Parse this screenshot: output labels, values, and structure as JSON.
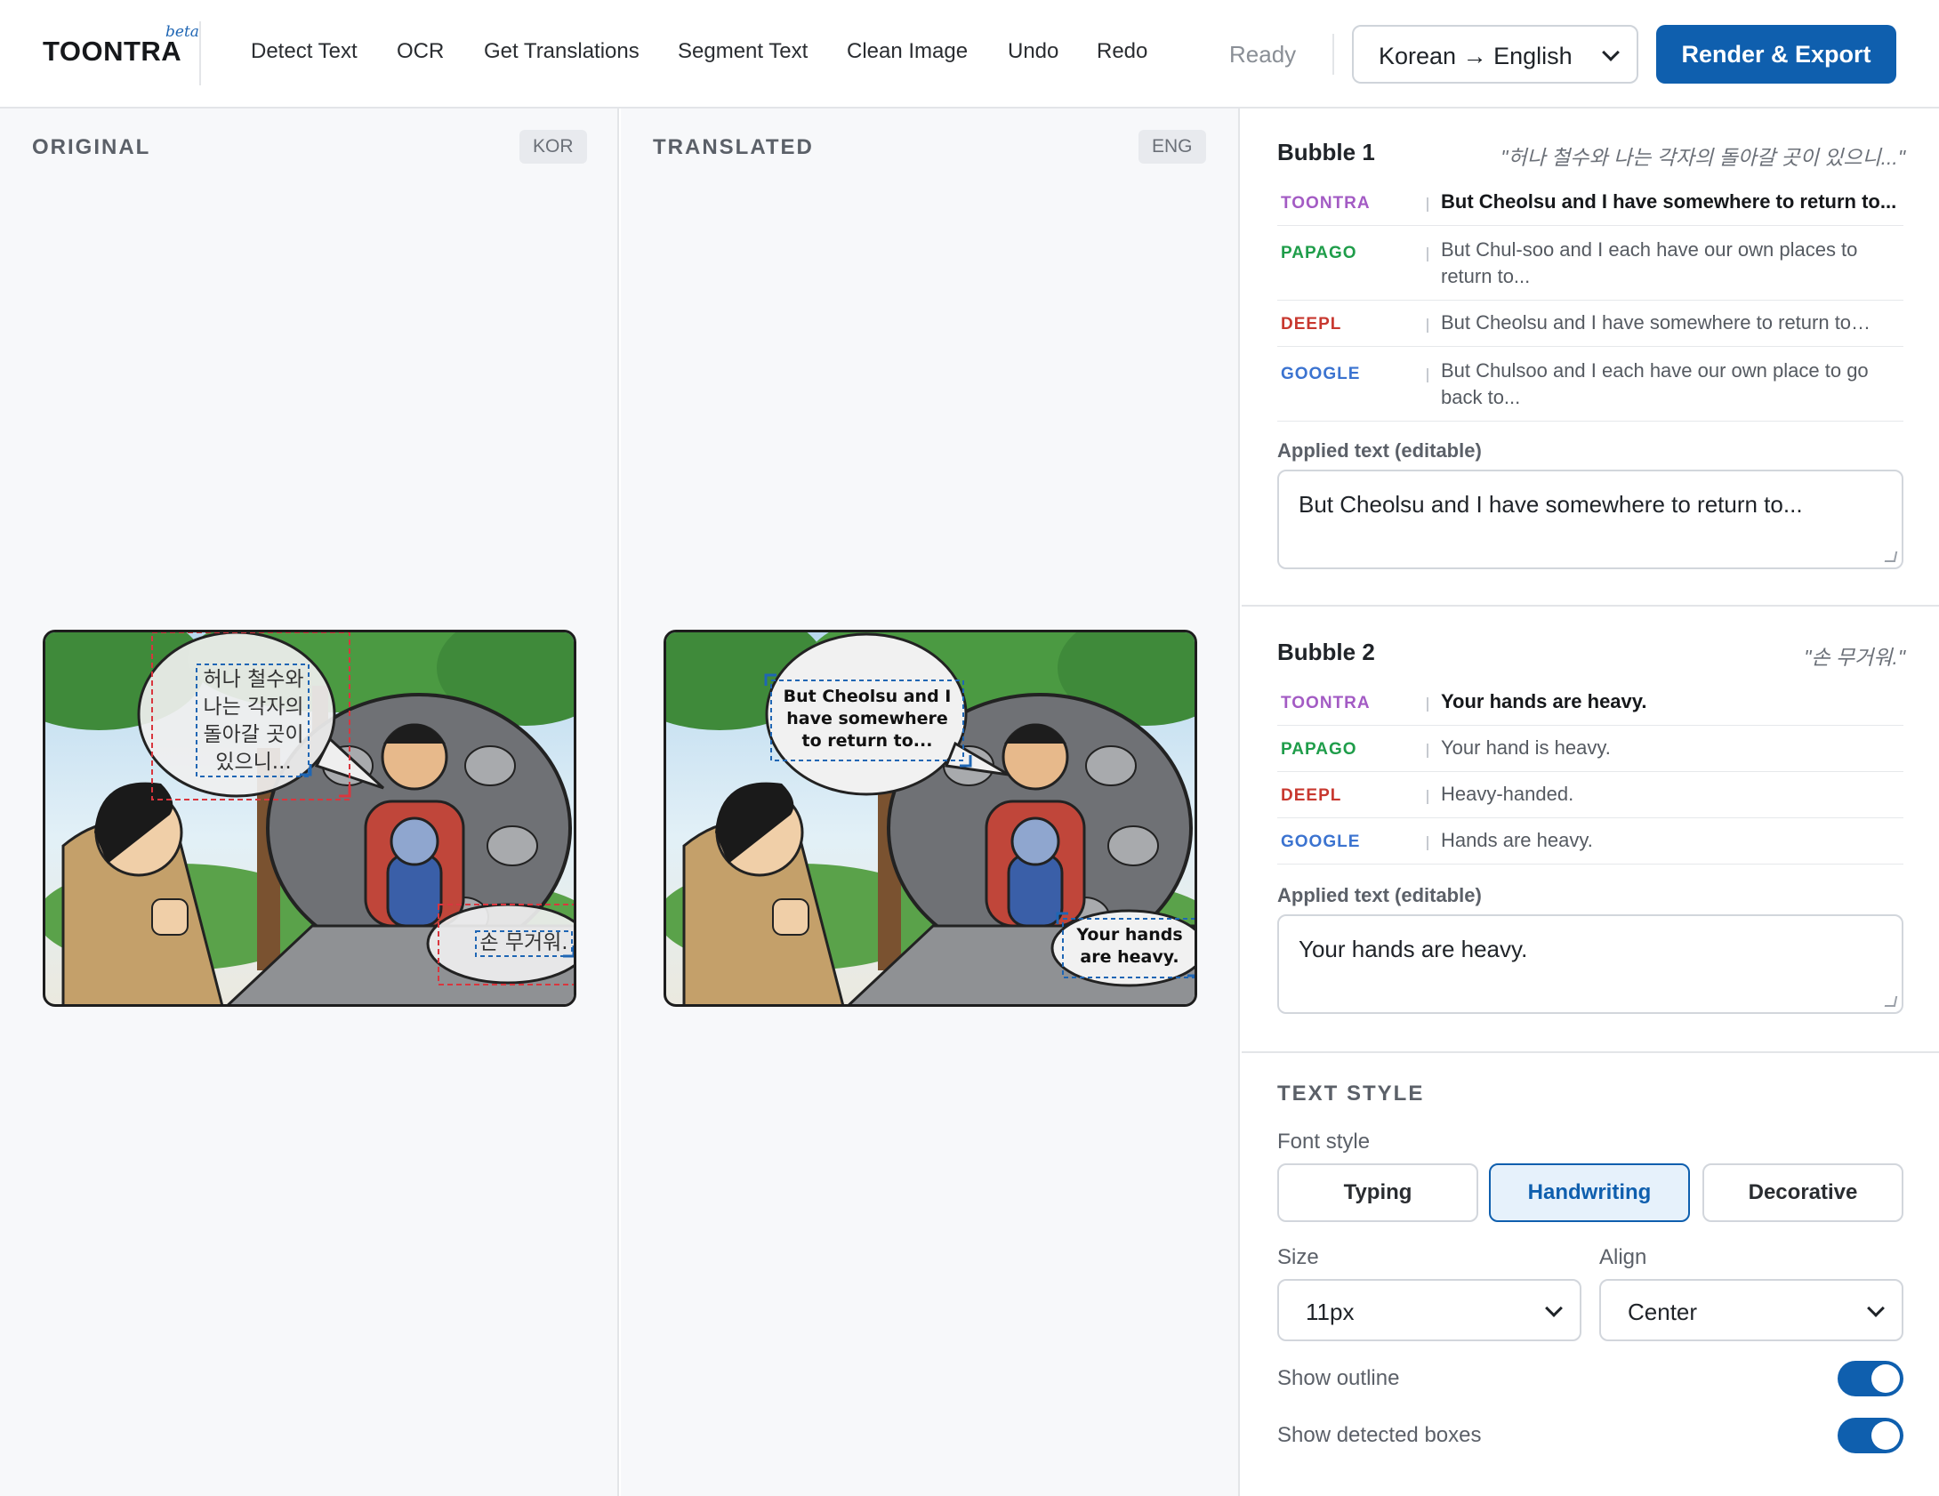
{
  "app": {
    "logo": "TOONTRA",
    "beta": "beta"
  },
  "toolbar": {
    "items": [
      "Detect Text",
      "OCR",
      "Get Translations",
      "Segment Text",
      "Clean Image",
      "Undo",
      "Redo"
    ],
    "status": "Ready",
    "language": "Korean → English",
    "export_label": "Render & Export"
  },
  "panes": {
    "original": {
      "title": "ORIGINAL",
      "badge": "KOR"
    },
    "translated": {
      "title": "TRANSLATED",
      "badge": "ENG"
    }
  },
  "comic": {
    "original": {
      "bubble1": [
        "허나 철수와",
        "나는 각자의",
        "돌아갈 곳이",
        "있으니..."
      ],
      "bubble2": "손 무거워."
    },
    "translated": {
      "bubble1": [
        "But Cheolsu and I",
        "have somewhere",
        "to return to..."
      ],
      "bubble2": [
        "Your hands",
        "are heavy."
      ]
    }
  },
  "bubbles": [
    {
      "title": "Bubble 1",
      "source": "\"허나 철수와 나는 각자의 돌아갈 곳이 있으니...\"",
      "engines": [
        {
          "name": "TOONTRA",
          "color": "#a35bc4",
          "text": "But Cheolsu and I have somewhere to return to..."
        },
        {
          "name": "PAPAGO",
          "color": "#1f9d4a",
          "text": "But Chul-soo and I each have our own places to return to..."
        },
        {
          "name": "DEEPL",
          "color": "#c8382f",
          "text": "But Cheolsu and I have somewhere to return to…"
        },
        {
          "name": "GOOGLE",
          "color": "#3b73d0",
          "text": "But Chulsoo and I each have our own place to go back to..."
        }
      ],
      "applied_label": "Applied text (editable)",
      "applied_text": "But Cheolsu and I have somewhere to return to..."
    },
    {
      "title": "Bubble 2",
      "source": "\"손 무거워.\"",
      "engines": [
        {
          "name": "TOONTRA",
          "color": "#a35bc4",
          "text": "Your hands are heavy."
        },
        {
          "name": "PAPAGO",
          "color": "#1f9d4a",
          "text": "Your hand is heavy."
        },
        {
          "name": "DEEPL",
          "color": "#c8382f",
          "text": "Heavy-handed."
        },
        {
          "name": "GOOGLE",
          "color": "#3b73d0",
          "text": "Hands are heavy."
        }
      ],
      "applied_label": "Applied text (editable)",
      "applied_text": "Your hands are heavy."
    }
  ],
  "text_style": {
    "heading": "TEXT STYLE",
    "font_style_label": "Font style",
    "font_styles": [
      "Typing",
      "Handwriting",
      "Decorative"
    ],
    "active_font_style": "Handwriting",
    "size_label": "Size",
    "size_value": "11px",
    "align_label": "Align",
    "align_value": "Center",
    "show_outline_label": "Show outline",
    "show_outline": true,
    "show_boxes_label": "Show detected boxes",
    "show_boxes": true
  },
  "colors": {
    "accent": "#0f5fae",
    "detect_box_red": "#d9363e",
    "detect_box_blue": "#1f66b4"
  }
}
